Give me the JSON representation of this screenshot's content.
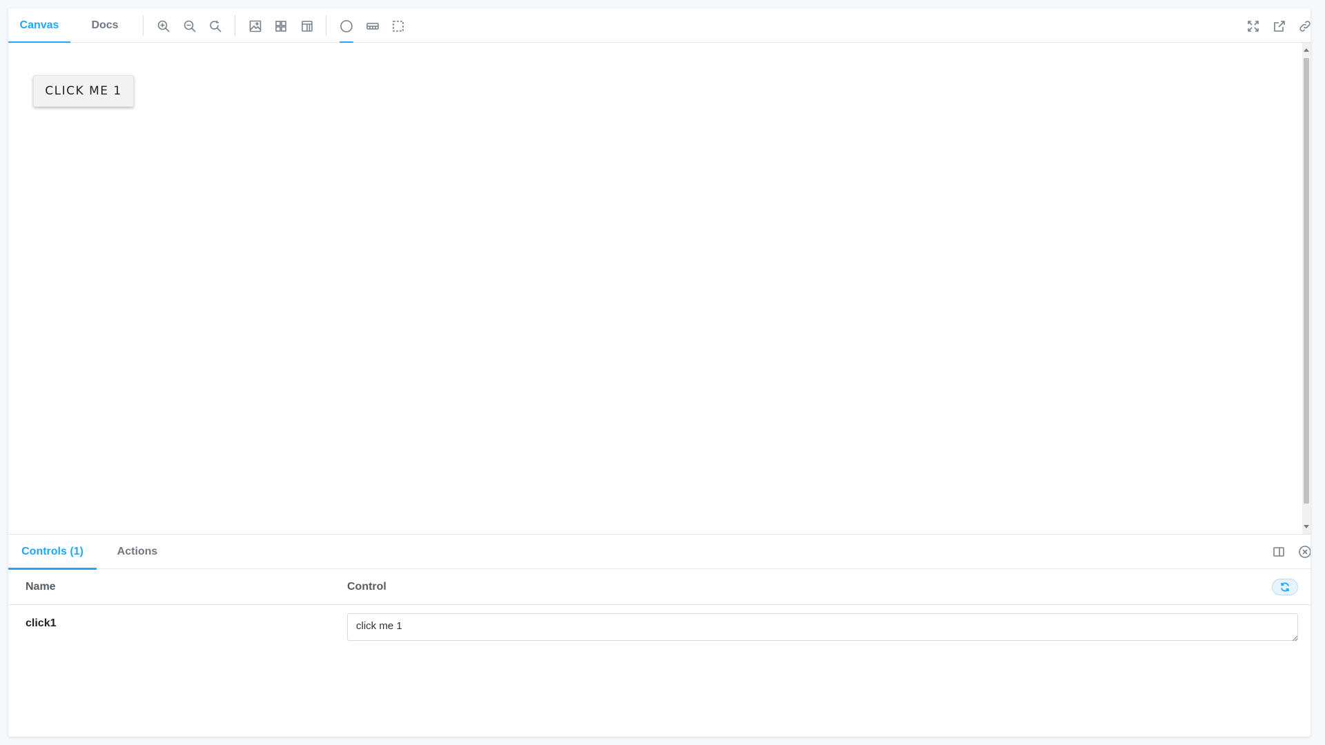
{
  "toolbar": {
    "tabs": [
      {
        "label": "Canvas",
        "active": true
      },
      {
        "label": "Docs",
        "active": false
      }
    ],
    "tools": [
      {
        "name": "zoom-in-icon"
      },
      {
        "name": "zoom-out-icon"
      },
      {
        "name": "zoom-reset-icon"
      },
      {
        "name": "background-icon"
      },
      {
        "name": "grid-icon"
      },
      {
        "name": "viewport-icon"
      },
      {
        "name": "outline-icon"
      },
      {
        "name": "measure-icon"
      },
      {
        "name": "fullscreen-icon"
      },
      {
        "name": "open-new-tab-icon"
      },
      {
        "name": "copy-link-icon"
      }
    ]
  },
  "canvas": {
    "demo_button_label": "CLICK ME 1"
  },
  "panel": {
    "tabs": [
      {
        "label": "Controls (1)",
        "active": true
      },
      {
        "label": "Actions",
        "active": false
      }
    ],
    "headers": {
      "name": "Name",
      "control": "Control"
    },
    "rows": [
      {
        "name": "click1",
        "value": "click me 1"
      }
    ]
  },
  "colors": {
    "accent": "#1ea7fd",
    "icon": "#76808a",
    "background": "#f6f9fc"
  }
}
